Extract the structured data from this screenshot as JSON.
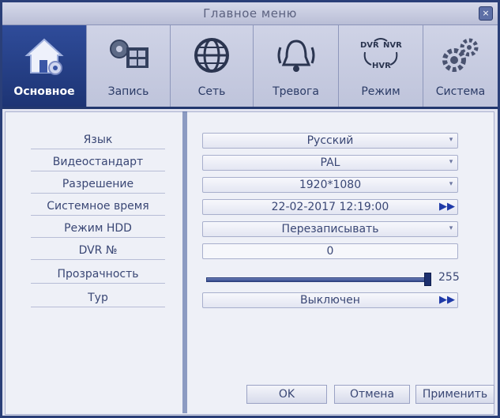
{
  "window": {
    "title": "Главное меню",
    "close_glyph": "×"
  },
  "tabs": [
    {
      "label": "Основное",
      "icon": "home-settings-icon",
      "active": true
    },
    {
      "label": "Запись",
      "icon": "record-film-icon",
      "active": false
    },
    {
      "label": "Сеть",
      "icon": "globe-icon",
      "active": false
    },
    {
      "label": "Тревога",
      "icon": "alarm-bell-icon",
      "active": false
    },
    {
      "label": "Режим",
      "icon": "dvr-nvr-hvr-mode-icon",
      "active": false
    },
    {
      "label": "Система",
      "icon": "gears-icon",
      "active": false
    }
  ],
  "mode_icon_text": {
    "dvr": "DVR",
    "nvr": "NVR",
    "hvr": "HVR"
  },
  "settings": [
    {
      "label": "Язык",
      "value": "Русский",
      "control": "dropdown"
    },
    {
      "label": "Видеостандарт",
      "value": "PAL",
      "control": "dropdown"
    },
    {
      "label": "Разрешение",
      "value": "1920*1080",
      "control": "dropdown"
    },
    {
      "label": "Системное время",
      "value": "22-02-2017 12:19:00",
      "control": "button"
    },
    {
      "label": "Режим HDD",
      "value": "Перезаписывать",
      "control": "dropdown"
    },
    {
      "label": "DVR №",
      "value": "0",
      "control": "input"
    },
    {
      "label": "Прозрачность",
      "value": "255",
      "control": "slider",
      "level": 1.0
    },
    {
      "label": "Тур",
      "value": "Выключен",
      "control": "button"
    }
  ],
  "glyphs": {
    "dropdown": "▾",
    "forward": "▶▶"
  },
  "buttons": {
    "ok": "OK",
    "cancel": "Отмена",
    "apply": "Применить"
  },
  "colors": {
    "active_tab": "#1d3474",
    "accent": "#2a3f78"
  }
}
